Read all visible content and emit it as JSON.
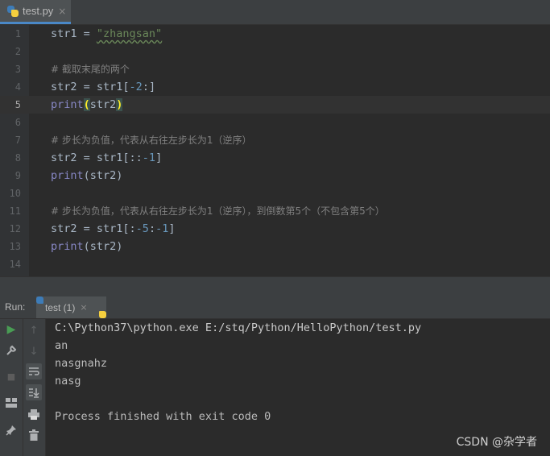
{
  "editor_tab": {
    "label": "test.py",
    "close": "×"
  },
  "lines": [
    {
      "n": "1"
    },
    {
      "n": "2"
    },
    {
      "n": "3"
    },
    {
      "n": "4"
    },
    {
      "n": "5"
    },
    {
      "n": "6"
    },
    {
      "n": "7"
    },
    {
      "n": "8"
    },
    {
      "n": "9"
    },
    {
      "n": "10"
    },
    {
      "n": "11"
    },
    {
      "n": "12"
    },
    {
      "n": "13"
    },
    {
      "n": "14"
    }
  ],
  "code": {
    "l1_var": "str1 = ",
    "l1_str": "\"zhangsan\"",
    "l3": "# 截取末尾的两个",
    "l4_a": "str2 = str1[",
    "l4_num": "-2",
    "l4_b": ":]",
    "l5_fn": "print",
    "l5_open": "(",
    "l5_arg": "str2",
    "l5_close": ")",
    "l7": "# 步长为负值，代表从右往左步长为1（逆序）",
    "l8_a": "str2 = str1[::",
    "l8_num": "-1",
    "l8_b": "]",
    "l9_fn": "print",
    "l9_rest": "(str2)",
    "l11": "# 步长为负值，代表从右往左步长为1（逆序），到倒数第5个（不包含第5个）",
    "l12_a": "str2 = str1[:",
    "l12_num1": "-5",
    "l12_colon": ":",
    "l12_num2": "-1",
    "l12_b": "]",
    "l13_fn": "print",
    "l13_rest": "(str2)"
  },
  "run": {
    "label": "Run:",
    "tab_label": "test (1)",
    "tab_close": "×",
    "console": [
      "C:\\Python37\\python.exe E:/stq/Python/HelloPython/test.py",
      "an",
      "nasgnahz",
      "nasg",
      "",
      "Process finished with exit code 0"
    ]
  },
  "watermark": "CSDN @杂学者",
  "icons": {
    "tab": "python-file-icon",
    "run_tab": "python-file-icon",
    "toolbar": [
      "rerun-icon",
      "wrench-icon",
      "stop-icon",
      "layout-icon",
      "pin-icon",
      "up-arrow-icon",
      "down-arrow-icon",
      "soft-wrap-icon",
      "scroll-to-end-icon",
      "print-icon",
      "trash-icon"
    ]
  },
  "colors": {
    "background": "#2b2b2b",
    "string": "#6a8759",
    "number": "#6897bb",
    "comment": "#808080",
    "builtin": "#8888c6",
    "accent": "#4a88c7"
  }
}
